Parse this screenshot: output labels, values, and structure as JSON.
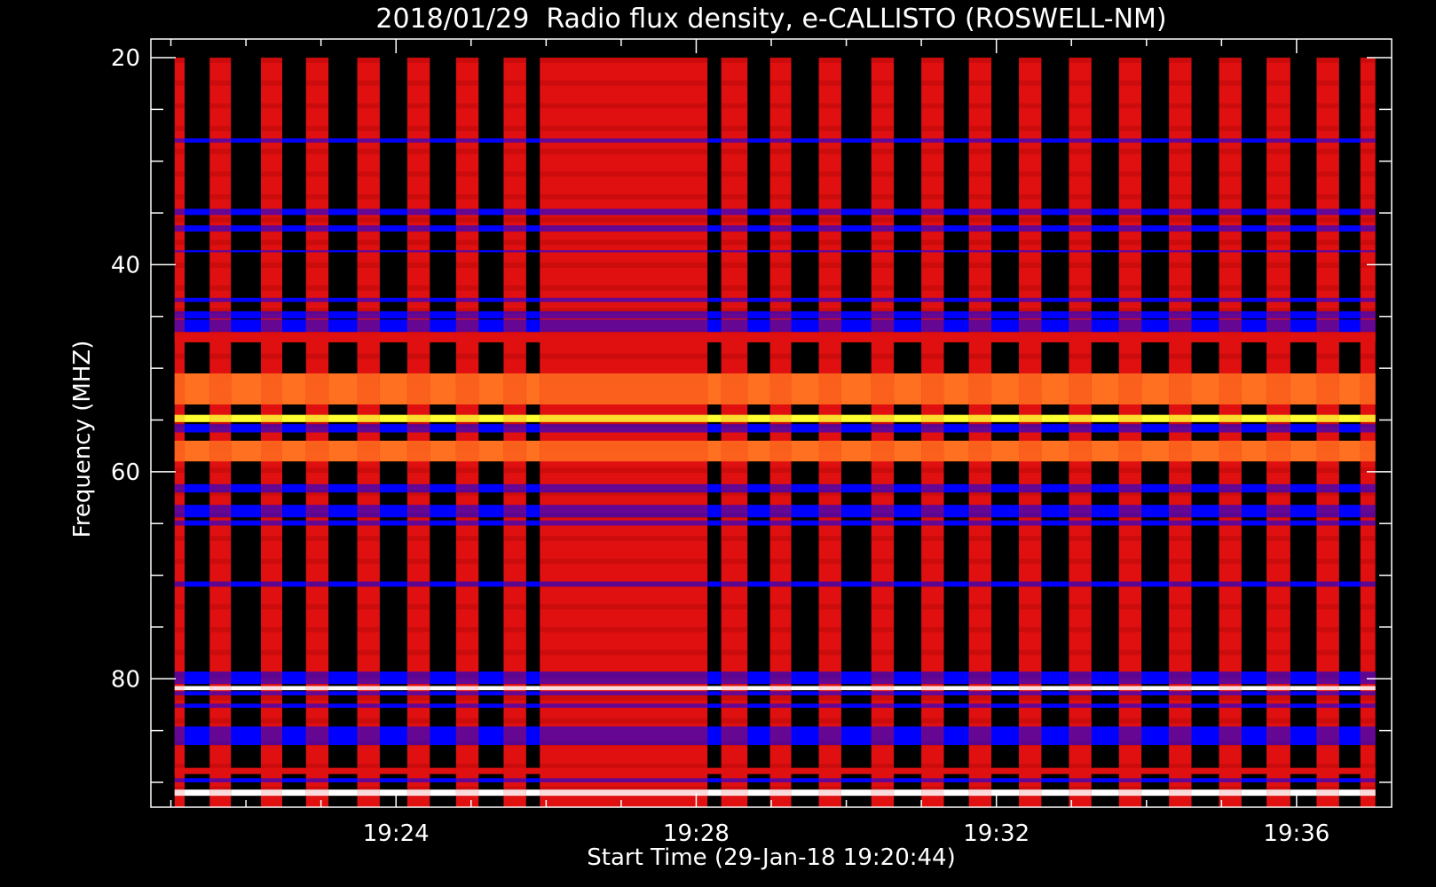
{
  "chart_data": {
    "type": "heatmap",
    "title": "2018/01/29  Radio flux density, e-CALLISTO (ROSWELL-NM)",
    "xlabel": "Start Time (29-Jan-18 19:20:44)",
    "ylabel": "Frequency (MHZ)",
    "x_unit": "time (HH:MM)",
    "y_unit": "MHz",
    "xlim": [
      "19:20:44",
      "19:37:16"
    ],
    "ylim": [
      18.2,
      92.4
    ],
    "y_inverted": true,
    "x_ticks": [
      "19:24",
      "19:28",
      "19:32",
      "19:36"
    ],
    "x_minor_ticks": [
      "19:21",
      "19:22",
      "19:23",
      "19:24",
      "19:25",
      "19:26",
      "19:27",
      "19:28",
      "19:29",
      "19:30",
      "19:31",
      "19:32",
      "19:33",
      "19:34",
      "19:35",
      "19:36"
    ],
    "y_ticks": [
      20,
      40,
      60,
      80
    ],
    "y_minor_tick_step": 5,
    "frequency_range_mhz": [
      20,
      92.4
    ],
    "colormap": "black-blue-red-yellow-white",
    "colors": {
      "background": "#000000",
      "frame": "#ffffff",
      "low": "#0000ff",
      "mid": "#e01010",
      "high": "#ffff30",
      "max": "#ffffff"
    },
    "time_strips": [
      {
        "start": "19:21:03",
        "end": "19:21:11"
      },
      {
        "start": "19:21:31",
        "end": "19:21:48"
      },
      {
        "start": "19:22:12",
        "end": "19:22:29"
      },
      {
        "start": "19:22:48",
        "end": "19:23:06"
      },
      {
        "start": "19:23:29",
        "end": "19:23:47"
      },
      {
        "start": "19:24:09",
        "end": "19:24:27"
      },
      {
        "start": "19:24:48",
        "end": "19:25:06"
      },
      {
        "start": "19:25:26",
        "end": "19:25:44"
      },
      {
        "start": "19:25:55",
        "end": "19:28:09"
      },
      {
        "start": "19:28:20",
        "end": "19:28:41"
      },
      {
        "start": "19:28:59",
        "end": "19:29:16"
      },
      {
        "start": "19:29:38",
        "end": "19:29:56"
      },
      {
        "start": "19:30:20",
        "end": "19:30:38"
      },
      {
        "start": "19:31:00",
        "end": "19:31:18"
      },
      {
        "start": "19:31:38",
        "end": "19:31:56"
      },
      {
        "start": "19:32:18",
        "end": "19:32:36"
      },
      {
        "start": "19:32:58",
        "end": "19:33:16"
      },
      {
        "start": "19:33:38",
        "end": "19:33:56"
      },
      {
        "start": "19:34:18",
        "end": "19:34:36"
      },
      {
        "start": "19:34:58",
        "end": "19:35:16"
      },
      {
        "start": "19:35:36",
        "end": "19:35:55"
      },
      {
        "start": "19:36:16",
        "end": "19:36:34"
      },
      {
        "start": "19:36:51",
        "end": "19:37:03"
      }
    ],
    "frequency_bands": [
      {
        "from": 20.0,
        "to": 28.0,
        "level": "mid"
      },
      {
        "from": 27.8,
        "to": 28.2,
        "level": "low"
      },
      {
        "from": 34.6,
        "to": 35.2,
        "level": "low"
      },
      {
        "from": 36.2,
        "to": 36.8,
        "level": "low"
      },
      {
        "from": 38.6,
        "to": 38.8,
        "level": "low"
      },
      {
        "from": 43.2,
        "to": 43.6,
        "level": "low"
      },
      {
        "from": 44.5,
        "to": 45.2,
        "level": "low"
      },
      {
        "from": 45.3,
        "to": 46.5,
        "level": "low"
      },
      {
        "from": 46.5,
        "to": 47.5,
        "level": "mid"
      },
      {
        "from": 50.5,
        "to": 53.5,
        "level": "mid-high"
      },
      {
        "from": 54.5,
        "to": 55.2,
        "level": "high"
      },
      {
        "from": 55.4,
        "to": 56.2,
        "level": "low"
      },
      {
        "from": 57.0,
        "to": 59.0,
        "level": "mid-high"
      },
      {
        "from": 61.2,
        "to": 62.0,
        "level": "low"
      },
      {
        "from": 63.2,
        "to": 64.4,
        "level": "low"
      },
      {
        "from": 64.7,
        "to": 65.2,
        "level": "low"
      },
      {
        "from": 70.6,
        "to": 71.1,
        "level": "low"
      },
      {
        "from": 79.3,
        "to": 80.5,
        "level": "low"
      },
      {
        "from": 80.7,
        "to": 81.1,
        "level": "max"
      },
      {
        "from": 81.2,
        "to": 81.6,
        "level": "low"
      },
      {
        "from": 82.4,
        "to": 82.8,
        "level": "low"
      },
      {
        "from": 84.6,
        "to": 86.4,
        "level": "low"
      },
      {
        "from": 88.6,
        "to": 89.2,
        "level": "mid"
      },
      {
        "from": 89.6,
        "to": 90.0,
        "level": "low"
      },
      {
        "from": 90.7,
        "to": 91.3,
        "level": "max"
      }
    ]
  }
}
